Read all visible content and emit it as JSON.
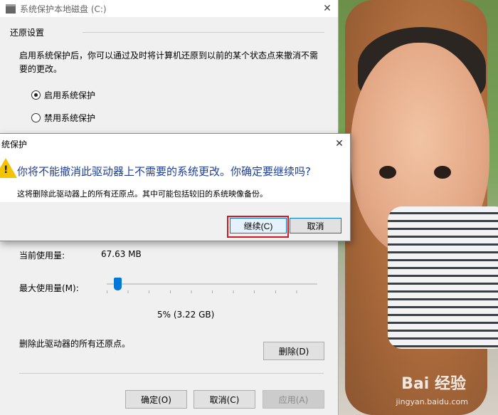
{
  "window": {
    "title": "系统保护本地磁盘 (C:)"
  },
  "restore_settings": {
    "group_title": "还原设置",
    "description": "启用系统保护后，你可以通过及时将计算机还原到以前的某个状态点来撤消不需要的更改。",
    "options": [
      {
        "label": "启用系统保护",
        "selected": true
      },
      {
        "label": "禁用系统保护",
        "selected": false
      }
    ]
  },
  "disk_usage": {
    "current_label": "当前使用量:",
    "current_value": "67.63 MB",
    "max_label": "最大使用量(M):",
    "max_percent_text": "5% (3.22 GB)",
    "slider_fraction": 0.05,
    "delete_text": "删除此驱动器的所有还原点。",
    "delete_button": "删除(D)"
  },
  "footer": {
    "ok": "确定(O)",
    "cancel": "取消(C)",
    "apply": "应用(A)"
  },
  "dialog": {
    "title": "统保护",
    "message": "你将不能撤消此驱动器上不需要的系统更改。你确定要继续吗?",
    "detail": "这将删除此驱动器上的所有还原点。其中可能包括较旧的系统映像备份。",
    "continue_button": "继续(C)",
    "cancel_button": "取消"
  },
  "watermark": {
    "brand": "Bai 经验",
    "url": "jingyan.baidu.com"
  },
  "colors": {
    "accent": "#0078d7",
    "highlight": "#d9181e",
    "dialog_message": "#1e3f9c"
  }
}
